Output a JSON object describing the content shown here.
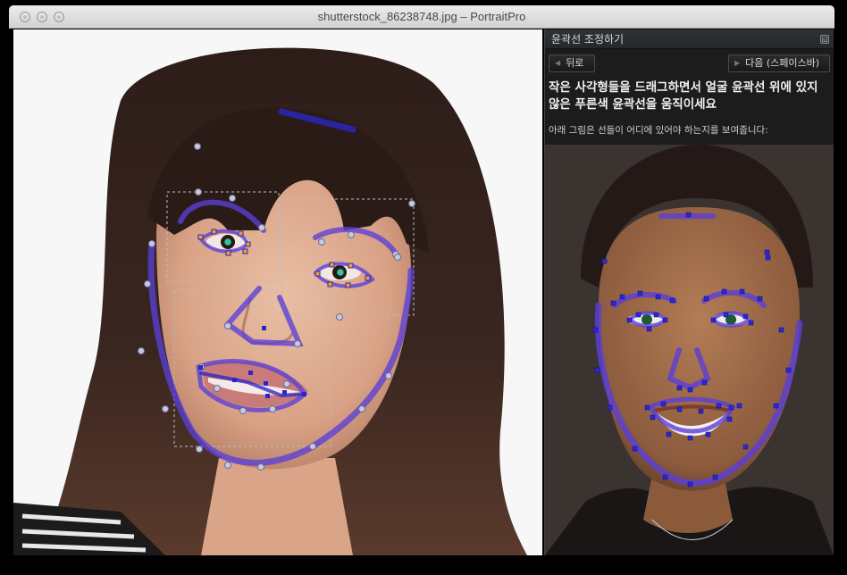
{
  "window": {
    "title": "shutterstock_86238748.jpg – PortraitPro"
  },
  "panel": {
    "title": "윤곽선 조정하기",
    "back_label": "뒤로",
    "next_label": "다음 (스페이스바)",
    "instruction": "작은 사각형들을 드래그하면서 얼굴 윤곽선 위에 있지 않은 푸른색 윤곽선을 움직이세요",
    "subtext": "아래 그림은 선들이 어디에 있어야 하는지를 보여줍니다:"
  },
  "colors": {
    "outline": "#5a3fd8",
    "handle_point": "#c8c8d8",
    "eye_handle": "#f3a21c",
    "ref_handle": "#2a26e0",
    "panel_bg": "#1c1c1c"
  }
}
